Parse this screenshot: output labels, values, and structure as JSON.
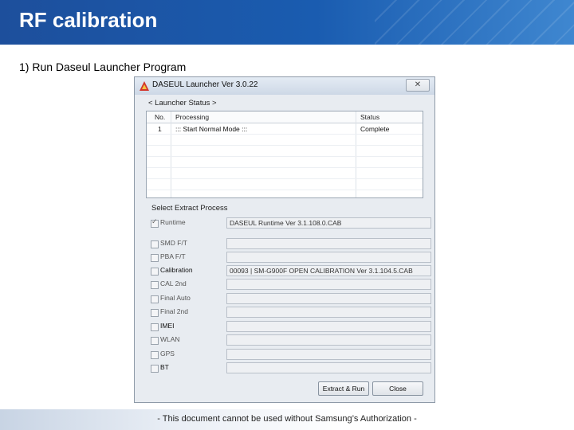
{
  "slide": {
    "title": "RF calibration",
    "step": "1) Run Daseul Launcher Program",
    "footer": "- This document cannot be used without Samsung’s Authorization -"
  },
  "window": {
    "title": "DASEUL Launcher Ver 3.0.22",
    "close_label": "✕",
    "launcher_status_label": "< Launcher Status >",
    "table": {
      "columns": [
        "No.",
        "Processing",
        "Status"
      ],
      "rows": [
        {
          "no": "1",
          "processing": "::: Start Normal Mode :::",
          "status": "Complete"
        }
      ]
    },
    "select_label": "Select Extract Process",
    "processes": [
      {
        "label": "Runtime",
        "checked": true,
        "value": "DASEUL Runtime Ver 3.1.108.0.CAB"
      },
      {
        "label": "SMD F/T",
        "checked": false,
        "value": ""
      },
      {
        "label": "PBA F/T",
        "checked": false,
        "value": ""
      },
      {
        "label": "Calibration",
        "checked": false,
        "value": "00093 | SM-G900F OPEN CALIBRATION Ver 3.1.104.5.CAB"
      },
      {
        "label": "CAL 2nd",
        "checked": false,
        "value": ""
      },
      {
        "label": "Final Auto",
        "checked": false,
        "value": ""
      },
      {
        "label": "Final 2nd",
        "checked": false,
        "value": ""
      },
      {
        "label": "IMEI",
        "checked": false,
        "value": ""
      },
      {
        "label": "WLAN",
        "checked": false,
        "value": ""
      },
      {
        "label": "GPS",
        "checked": false,
        "value": ""
      },
      {
        "label": "BT",
        "checked": false,
        "value": ""
      }
    ],
    "buttons": {
      "extract_run": "Extract & Run",
      "close": "Close"
    }
  }
}
